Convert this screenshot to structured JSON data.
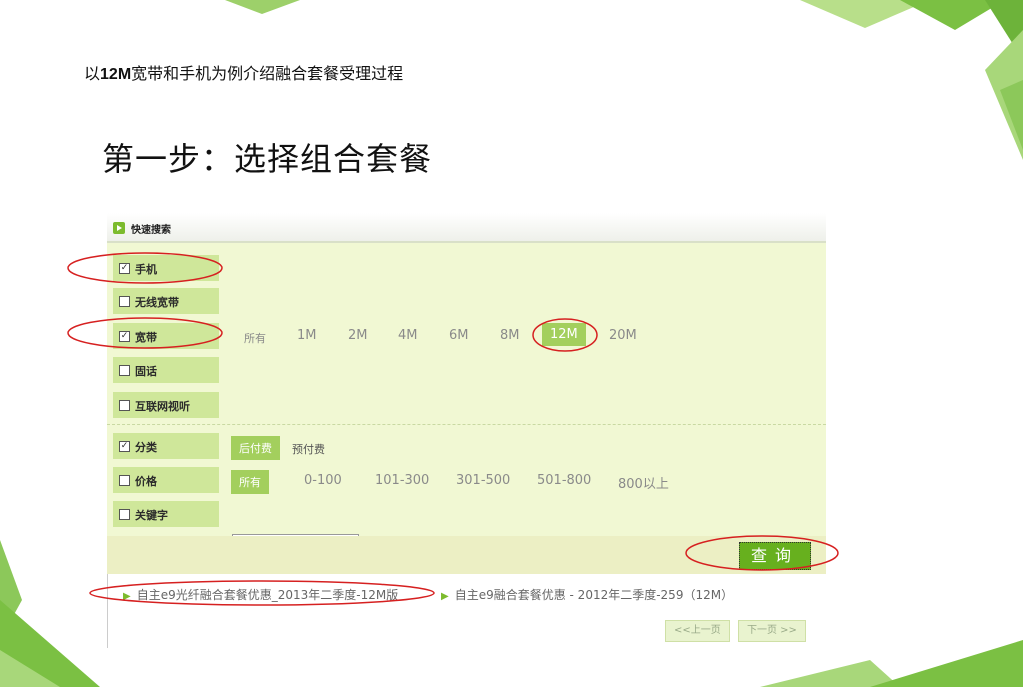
{
  "slide": {
    "subtitle_prefix": "以",
    "subtitle_bold": "12M",
    "subtitle_rest": "宽带和手机为例介绍融合套餐受理过程",
    "heading": "第一步：选择组合套餐"
  },
  "panel": {
    "title": "快速搜索",
    "filters": [
      {
        "label": "手机",
        "checked": true
      },
      {
        "label": "无线宽带",
        "checked": false
      },
      {
        "label": "宽带",
        "checked": true
      },
      {
        "label": "固话",
        "checked": false
      },
      {
        "label": "互联网视听",
        "checked": false
      },
      {
        "label": "分类",
        "checked": true
      },
      {
        "label": "价格",
        "checked": false
      },
      {
        "label": "关键字",
        "checked": false
      }
    ],
    "bandwidth_options": [
      "所有",
      "1M",
      "2M",
      "4M",
      "6M",
      "8M",
      "12M",
      "20M"
    ],
    "bandwidth_selected": "12M",
    "category_options": [
      "后付费",
      "预付费"
    ],
    "category_selected": "后付费",
    "price_options": [
      "所有",
      "0-100",
      "101-300",
      "301-500",
      "501-800",
      "800以上"
    ],
    "price_selected": "所有",
    "keyword_value": "",
    "query_button": "查询",
    "results": [
      "自主e9光纤融合套餐优惠_2013年二季度-12M版",
      "自主e9融合套餐优惠 - 2012年二季度-259（12M）"
    ],
    "prev_page": "<<上一页",
    "next_page": "下一页 >>"
  },
  "colors": {
    "accent_green": "#67b01e",
    "label_green": "#cfe79a",
    "panel_bg": "#f1f8d3",
    "highlight_red": "#d62020"
  }
}
